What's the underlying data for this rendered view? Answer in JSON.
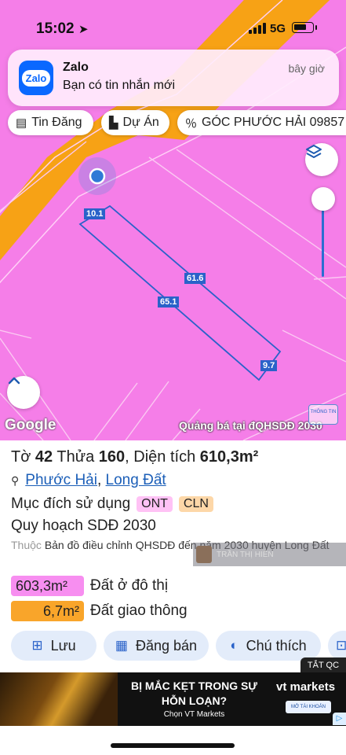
{
  "status_bar": {
    "time": "15:02",
    "network": "5G"
  },
  "notification": {
    "app": "Zalo",
    "icon_text": "Zalo",
    "message": "Bạn có tin nhắn mới",
    "time": "bây giờ"
  },
  "chips": [
    {
      "icon": "newspaper-icon",
      "label": "Tin Đăng"
    },
    {
      "icon": "buildings-icon",
      "label": "Dự Án"
    },
    {
      "icon": "percent-icon",
      "label": "GÓC PHƯỚC HẢI 09857"
    }
  ],
  "map": {
    "edge_labels": [
      "10.1",
      "61.6",
      "65.1",
      "9.7"
    ],
    "google_logo": "Google",
    "promo": "Quảng bá tại đQHSDĐ 2030",
    "badge": "THÔNG TIN"
  },
  "parcel": {
    "sheet_label": "Tờ",
    "sheet": "42",
    "lot_label": "Thửa",
    "lot": "160",
    "area_label": "Diện tích",
    "area": "610,3m²",
    "ward": "Phước Hải",
    "district": "Long Đất",
    "purpose_label": "Mục đích sử dụng",
    "purpose_tags": [
      "ONT",
      "CLN"
    ],
    "plan": "Quy hoạch SDĐ 2030",
    "belongs_prefix": "Thuộc",
    "belongs": "Bản đồ điều chỉnh QHSDĐ đến năm 2030 huyện Long Đất",
    "watermark": "TRẦN THỊ HIỀN",
    "areas": [
      {
        "value": "603,3m²",
        "label": "Đất ở đô thị",
        "color": "#f78ef0"
      },
      {
        "value": "6,7m²",
        "label": "Đất giao thông",
        "color": "#f9a52a"
      }
    ]
  },
  "actions": [
    {
      "icon": "add-file-icon",
      "label": "Lưu"
    },
    {
      "icon": "table-icon",
      "label": "Đăng bán"
    },
    {
      "icon": "contrast-icon",
      "label": "Chú thích"
    }
  ],
  "ad": {
    "close_label": "TẮT QC",
    "headline_1": "BỊ MẮC KẸT TRONG SỰ",
    "headline_2": "HỖN LOẠN?",
    "sub": "Chọn VT Markets",
    "brand": "vt markets",
    "cta": "MỞ TÀI KHOẢN"
  },
  "colors": {
    "map_land": "#f57ee8",
    "road": "#f7a215",
    "parcel_line": "#2a62c9",
    "accent": "#2a62c9"
  }
}
